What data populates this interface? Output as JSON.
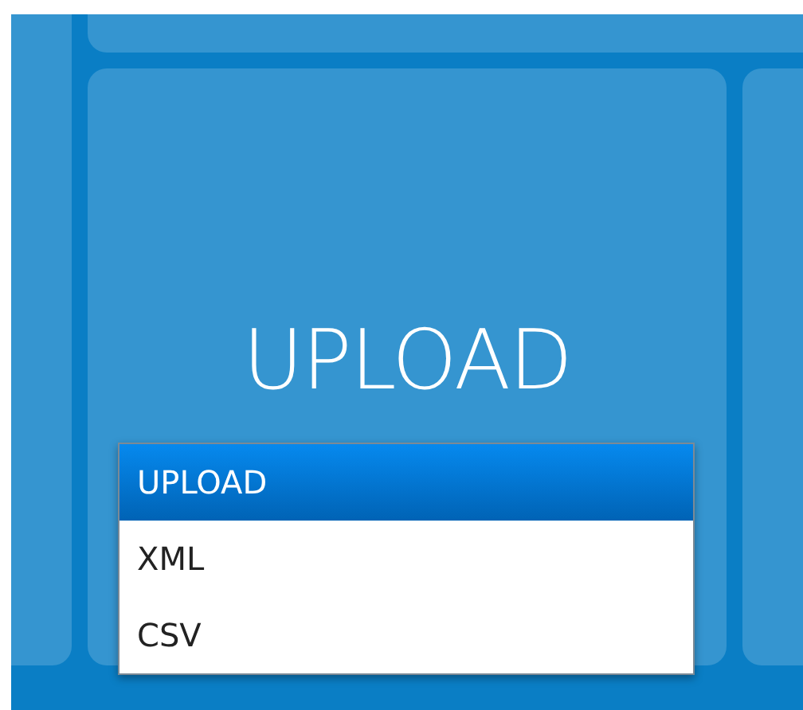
{
  "tile": {
    "title": "UPLOAD"
  },
  "dropdown": {
    "items": [
      {
        "label": "UPLOAD",
        "selected": true
      },
      {
        "label": "XML",
        "selected": false
      },
      {
        "label": "CSV",
        "selected": false
      }
    ]
  }
}
